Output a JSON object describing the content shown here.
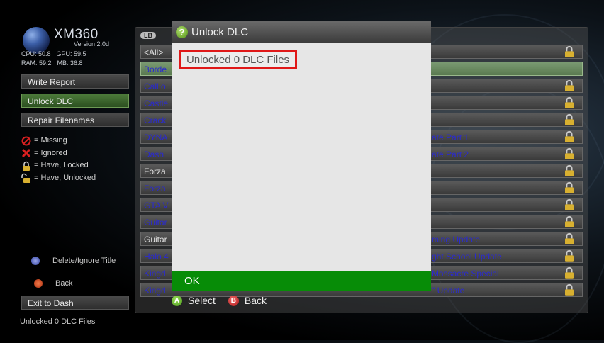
{
  "app": {
    "title": "XM360",
    "version": "Version 2.0d",
    "stats": {
      "cpu": "CPU: 50.8",
      "gpu": "GPU: 59.5",
      "ram": "RAM: 59.2",
      "mb": "MB: 36.8"
    }
  },
  "sidebar": {
    "buttons": [
      {
        "label": "Write Report"
      },
      {
        "label": "Unlock DLC",
        "active": true
      },
      {
        "label": "Repair Filenames"
      }
    ],
    "legend": [
      {
        "icon": "missing-icon",
        "label": "= Missing"
      },
      {
        "icon": "ignored-icon",
        "label": "= Ignored"
      },
      {
        "icon": "lock-icon",
        "label": "= Have, Locked"
      },
      {
        "icon": "unlock-icon",
        "label": "= Have, Unlocked"
      }
    ],
    "hints": {
      "delete": "Delete/Ignore Title",
      "back": "Back"
    },
    "exit_label": "Exit to Dash",
    "status": "Unlocked 0 DLC Files"
  },
  "list": {
    "filter": "<All>",
    "lb_label": "LB",
    "rows": [
      {
        "left": "Borde",
        "right": ""
      },
      {
        "left": "Call o",
        "right": ""
      },
      {
        "left": "Castle",
        "right": ""
      },
      {
        "left": "Crack",
        "right": ""
      },
      {
        "left": "DYNA",
        "right": "ate Part 1"
      },
      {
        "left": "Dash ",
        "right": "ate Part 2"
      },
      {
        "left": "Forza",
        "right": ""
      },
      {
        "left": "Forza",
        "right": ""
      },
      {
        "left": "GTA V",
        "right": ""
      },
      {
        "left": "Guitar",
        "right": ""
      },
      {
        "left": "Guitar",
        "right": "ming Update"
      },
      {
        "left": "Halo 4",
        "right": "ght School Update"
      },
      {
        "left": "Kingd",
        "right": "Massacre Special"
      },
      {
        "left": "Kingd",
        "right": "\" Update"
      }
    ]
  },
  "dialog": {
    "title": "Unlock DLC",
    "message": "Unlocked 0 DLC Files",
    "ok_label": "OK",
    "hint_select": "Select",
    "hint_back": "Back",
    "btn_a": "A",
    "btn_b": "B"
  },
  "colors": {
    "accent_green": "#078c07",
    "highlight_red": "#e01818",
    "link_blue": "#2a2ad0"
  }
}
